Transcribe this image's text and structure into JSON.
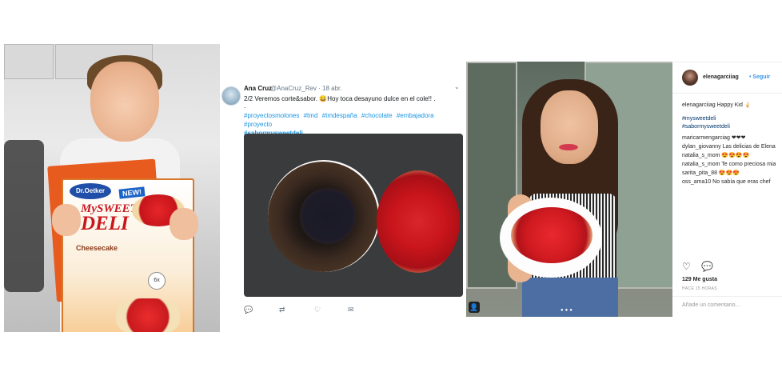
{
  "photo1": {
    "box": {
      "logo": "Dr.Oetker",
      "badge": "NEW!",
      "title_line1": "MySWEET",
      "title_line2": "DELI",
      "subtitle": "Cheesecake",
      "size_badge": "6x"
    }
  },
  "tweet": {
    "name": "Ana Cruz",
    "handle": "@AnaCruz_Rev · 18 abr.",
    "text": "2/2 Veremos corte&sabor. 😀Hoy toca desayuno dulce en el cole!! .",
    "dot": ".",
    "hashtags": [
      "#proyectosmolones",
      "#tmd",
      "#tmdespaña",
      "#chocolate",
      "#embajadora",
      "#proyecto"
    ],
    "hashtag_strong": "#sabormysweetdeli",
    "chevron": "⌄",
    "actions": {
      "reply": "💬",
      "retweet": "⇄",
      "like": "♡",
      "message": "✉"
    }
  },
  "photo3": {
    "user_tag": "👤",
    "carousel_dots": "●●●"
  },
  "instagram": {
    "username": "elenagarciiag",
    "follow": "• Seguir",
    "caption": "elenagarciiag Happy Kid 🍦",
    "tags": [
      "#mysweetdeli",
      "#sabormysweetdeli"
    ],
    "comments": [
      "maricarmengarciag ❤❤❤",
      "dylan_giovanny Las delicias de Elena",
      "natalia_s_mom 😍😍😍😍",
      "natalia_s_mom Te como preciosa mia",
      "sarita_pita_88 😍😍😍",
      "oss_ama10 No sabía que eras chef"
    ],
    "like_icon": "♡",
    "comment_icon": "💬",
    "likes": "129 Me gusta",
    "time": "HACE 15 HORAS",
    "comment_placeholder": "Añade un comentario..."
  },
  "colors": {
    "twitter_link": "#1b95e0",
    "instagram_follow": "#3897f0",
    "instagram_tag": "#003569"
  }
}
